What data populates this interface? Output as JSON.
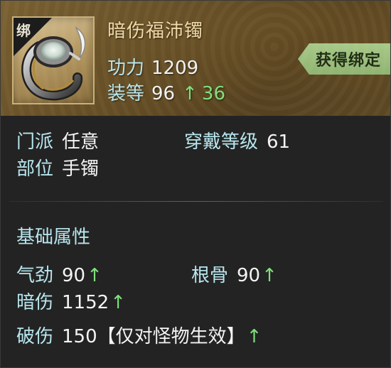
{
  "item": {
    "bind_corner": "绑",
    "name": "暗伤福沛镯",
    "power_label": "功力",
    "power_value": "1209",
    "gear_label": "装等",
    "gear_value": "96",
    "gear_up_arrow": "↑",
    "gear_up_value": "36",
    "bound_tag": "获得绑定"
  },
  "info": {
    "school_label": "门派",
    "school_value": "任意",
    "wear_level_label": "穿戴等级",
    "wear_level_value": "61",
    "slot_label": "部位",
    "slot_value": "手镯"
  },
  "base": {
    "title": "基础属性",
    "attributes": [
      {
        "label": "气劲",
        "value": "90",
        "arrow": "↑"
      },
      {
        "label": "根骨",
        "value": "90",
        "arrow": "↑"
      },
      {
        "label": "暗伤",
        "value": "1152",
        "arrow": "↑"
      }
    ],
    "break": {
      "label": "破伤",
      "value": "150",
      "note": "【仅对怪物生效】",
      "arrow": "↑"
    }
  },
  "colors": {
    "accent_cyan": "#b8e6ee",
    "up_green": "#7fe07b",
    "name_gold": "#f0d9a8",
    "tag_green": "#a7c989"
  }
}
